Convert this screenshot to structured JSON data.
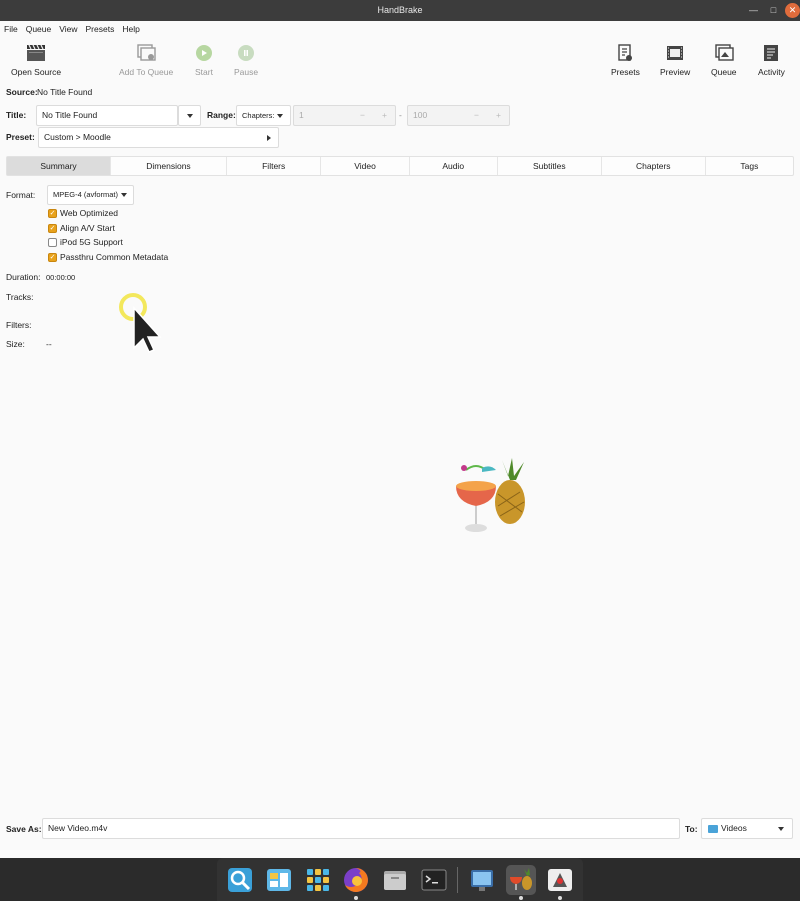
{
  "window": {
    "title": "HandBrake"
  },
  "menu": [
    "File",
    "Queue",
    "View",
    "Presets",
    "Help"
  ],
  "toolbar": {
    "open_source": "Open Source",
    "add_to_queue": "Add To Queue",
    "start": "Start",
    "pause": "Pause",
    "presets": "Presets",
    "preview": "Preview",
    "queue": "Queue",
    "activity": "Activity"
  },
  "source": {
    "label": "Source:",
    "value": "No Title Found"
  },
  "title": {
    "label": "Title:",
    "value": "No Title Found"
  },
  "range": {
    "label": "Range:",
    "mode": "Chapters:",
    "start": "1",
    "end": "100",
    "dash": "-",
    "minus": "−",
    "plus": "+"
  },
  "preset": {
    "label": "Preset:",
    "value": "Custom > Moodle"
  },
  "tabs": [
    "Summary",
    "Dimensions",
    "Filters",
    "Video",
    "Audio",
    "Subtitles",
    "Chapters",
    "Tags"
  ],
  "summary": {
    "format_label": "Format:",
    "format_value": "MPEG-4 (avformat)",
    "options": [
      {
        "label": "Web Optimized",
        "checked": true
      },
      {
        "label": "Align A/V Start",
        "checked": true
      },
      {
        "label": "iPod 5G Support",
        "checked": false
      },
      {
        "label": "Passthru Common Metadata",
        "checked": true
      }
    ],
    "duration_label": "Duration:",
    "duration_value": "00:00:00",
    "tracks_label": "Tracks:",
    "filters_label": "Filters:",
    "size_label": "Size:",
    "size_value": "--"
  },
  "save": {
    "label": "Save As:",
    "value": "New Video.m4v",
    "to_label": "To:",
    "folder": "Videos"
  },
  "colors": {
    "accent_check": "#e8a21c",
    "titlebar": "#3c3c3c",
    "close": "#e06c3c"
  },
  "dock": [
    "search-app",
    "files-manager",
    "app-grid",
    "firefox",
    "file-manager",
    "terminal",
    "screen-recorder",
    "handbrake",
    "installer"
  ]
}
